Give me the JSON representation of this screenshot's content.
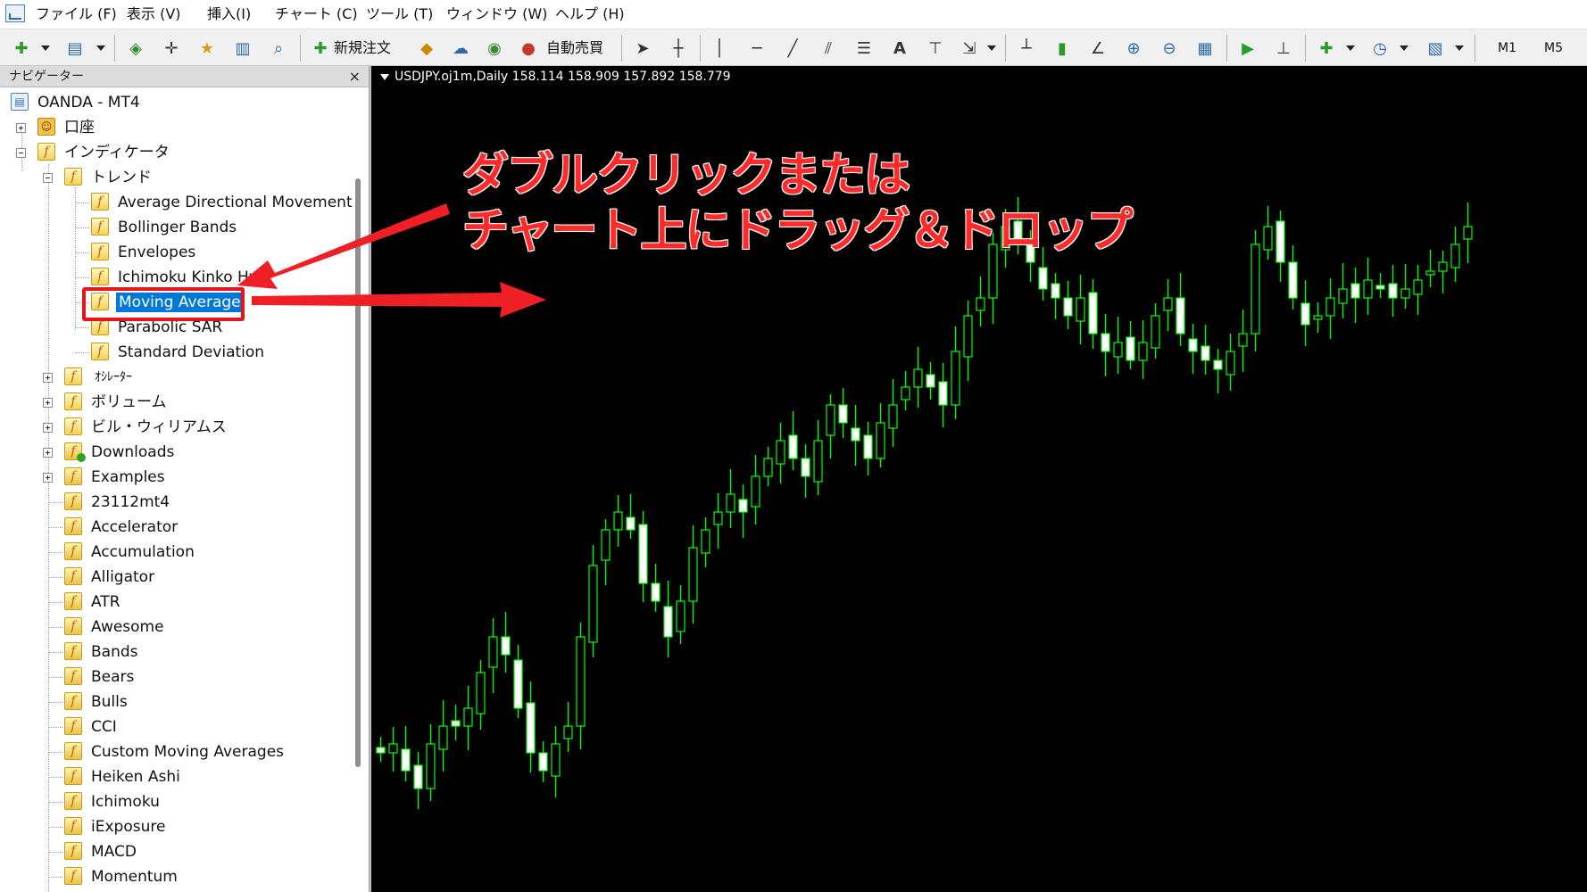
{
  "menu": {
    "items": [
      "ファイル (F)",
      "表示 (V)",
      "挿入(I)",
      "チャート (C)",
      "ツール (T)",
      "ウィンドウ (W)",
      "ヘルプ (H)"
    ]
  },
  "toolbar": {
    "new_order_label": "新規注文",
    "auto_trade_label": "自動売買",
    "timeframes": [
      "M1",
      "M5"
    ]
  },
  "navigator": {
    "title": "ナビゲーター",
    "close_label": "×",
    "root": "OANDA - MT4",
    "accounts": "口座",
    "indicators": "インディケータ",
    "trend": "トレンド",
    "trend_items": [
      "Average Directional Movement I",
      "Bollinger Bands",
      "Envelopes",
      "Ichimoku Kinko Hyo",
      "Moving Average",
      "Parabolic SAR",
      "Standard Deviation"
    ],
    "selected_item": "Moving Average",
    "groups": [
      "ｵｼﾚｰﾀｰ",
      "ボリューム",
      "ビル・ウィリアムス",
      "Downloads",
      "Examples"
    ],
    "custom_items": [
      "23112mt4",
      "Accelerator",
      "Accumulation",
      "Alligator",
      "ATR",
      "Awesome",
      "Bands",
      "Bears",
      "Bulls",
      "CCI",
      "Custom Moving Averages",
      "Heiken Ashi",
      "Ichimoku",
      "iExposure",
      "MACD",
      "Momentum"
    ]
  },
  "chart": {
    "title": "USDJPY.oj1m,Daily  158.114 158.909 157.892 158.779",
    "background": "#000000",
    "bull_color": "#00ff00",
    "bear_fill": "#ffffff"
  },
  "annotation": {
    "line1": "ダブルクリックまたは",
    "line2": "チャート上にドラッグ＆ドロップ",
    "color": "#ff2b2b"
  }
}
